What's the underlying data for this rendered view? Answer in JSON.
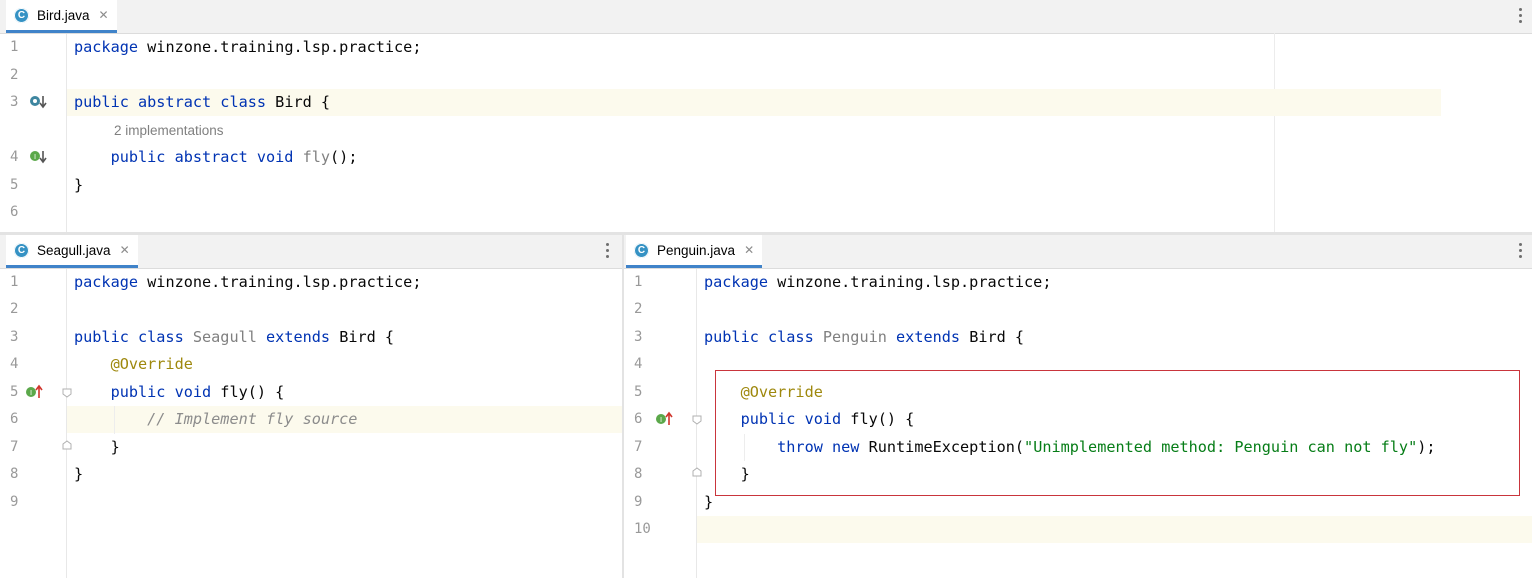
{
  "panes": {
    "top": {
      "tab_label": "Bird.java",
      "tab_icon": "class-c-icon",
      "line_numbers": [
        "1",
        "2",
        "3",
        "4",
        "5",
        "6"
      ],
      "lines": {
        "l1_kw": "package",
        "l1_rest": " winzone.training.lsp.practice;",
        "l3_kw": "public abstract class",
        "l3_rest": " Bird {",
        "inlay_hint": "2 implementations",
        "l4_indent": "    ",
        "l4_kw": "public abstract void",
        "l4_method": " fly",
        "l4_rest": "();",
        "l5": "}"
      }
    },
    "left": {
      "tab_label": "Seagull.java",
      "tab_icon": "class-c-icon",
      "line_numbers": [
        "1",
        "2",
        "3",
        "4",
        "5",
        "6",
        "7",
        "8",
        "9"
      ],
      "lines": {
        "l1_kw": "package",
        "l1_rest": " winzone.training.lsp.practice;",
        "l3_kw": "public class",
        "l3_cls": " Seagull",
        "l3_kw2": " extends",
        "l3_rest": " Bird {",
        "l4_ann": "    @Override",
        "l5_kw": "    public void",
        "l5_rest": " fly() {",
        "l6_cmt": "        // Implement fly source",
        "l7": "    }",
        "l8": "}"
      }
    },
    "right": {
      "tab_label": "Penguin.java",
      "tab_icon": "class-c-icon",
      "line_numbers": [
        "1",
        "2",
        "3",
        "4",
        "5",
        "6",
        "7",
        "8",
        "9",
        "10"
      ],
      "lines": {
        "l1_kw": "package",
        "l1_rest": " winzone.training.lsp.practice;",
        "l3_kw": "public class",
        "l3_cls": " Penguin",
        "l3_kw2": " extends",
        "l3_rest": " Bird {",
        "l5_ann": "    @Override",
        "l6_kw": "    public void",
        "l6_rest": " fly() {",
        "l7_kw": "        throw new",
        "l7_mid": " RuntimeException(",
        "l7_str": "\"Unimplemented method: Penguin can not fly\"",
        "l7_end": ");",
        "l8": "    }",
        "l9": "}"
      }
    }
  },
  "colors": {
    "keyword": "#0033b3",
    "annotation": "#9e880d",
    "string": "#067d17",
    "comment": "#8c8c8c",
    "current_line": "#fcfaed",
    "highlight_box": "#c9353c",
    "tab_underline": "#4083c9"
  }
}
